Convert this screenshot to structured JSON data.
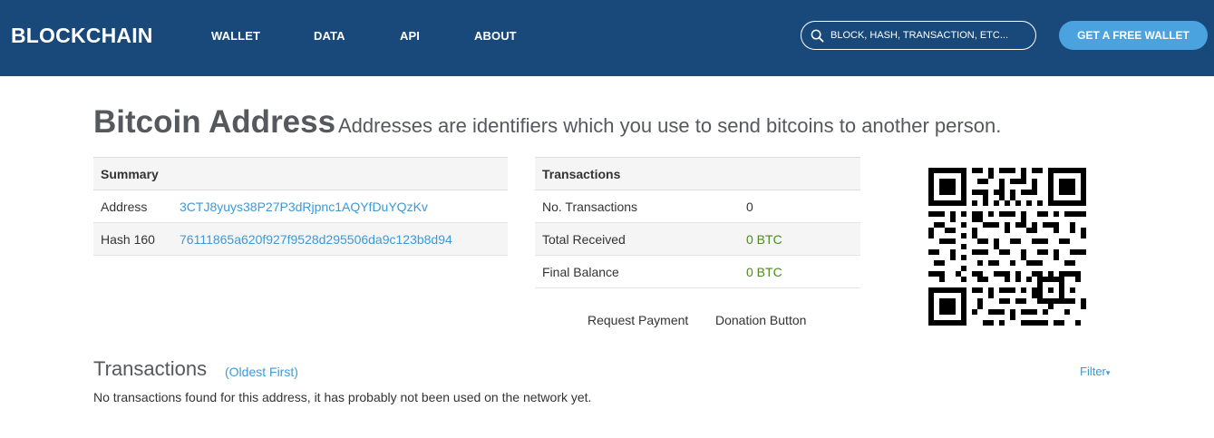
{
  "header": {
    "brand": "BLOCKCHAIN",
    "nav": [
      "WALLET",
      "DATA",
      "API",
      "ABOUT"
    ],
    "search_placeholder": "BLOCK, HASH, TRANSACTION, ETC...",
    "cta_label": "GET A FREE WALLET",
    "colors": {
      "background": "#19497b",
      "cta": "#4aa3df"
    }
  },
  "title": {
    "main": "Bitcoin Address",
    "subtitle": "Addresses are identifiers which you use to send bitcoins to another person."
  },
  "summary": {
    "header": "Summary",
    "rows": [
      {
        "label": "Address",
        "value": "3CTJ8yuys38P27P3dRjpnc1AQYfDuYQzKv"
      },
      {
        "label": "Hash 160",
        "value": "76111865a620f927f9528d295506da9c123b8d94"
      }
    ]
  },
  "transactions_summary": {
    "header": "Transactions",
    "rows": [
      {
        "label": "No. Transactions",
        "value": "0"
      },
      {
        "label": "Total Received",
        "value": "0 BTC"
      },
      {
        "label": "Final Balance",
        "value": "0 BTC"
      }
    ]
  },
  "buttons": {
    "request_payment": "Request Payment",
    "donation_button": "Donation Button"
  },
  "qr_icon": "qr-code",
  "transactions": {
    "heading": "Transactions",
    "order": "(Oldest First)",
    "filter": "Filter",
    "empty_message": "No transactions found for this address, it has probably not been used on the network yet."
  }
}
